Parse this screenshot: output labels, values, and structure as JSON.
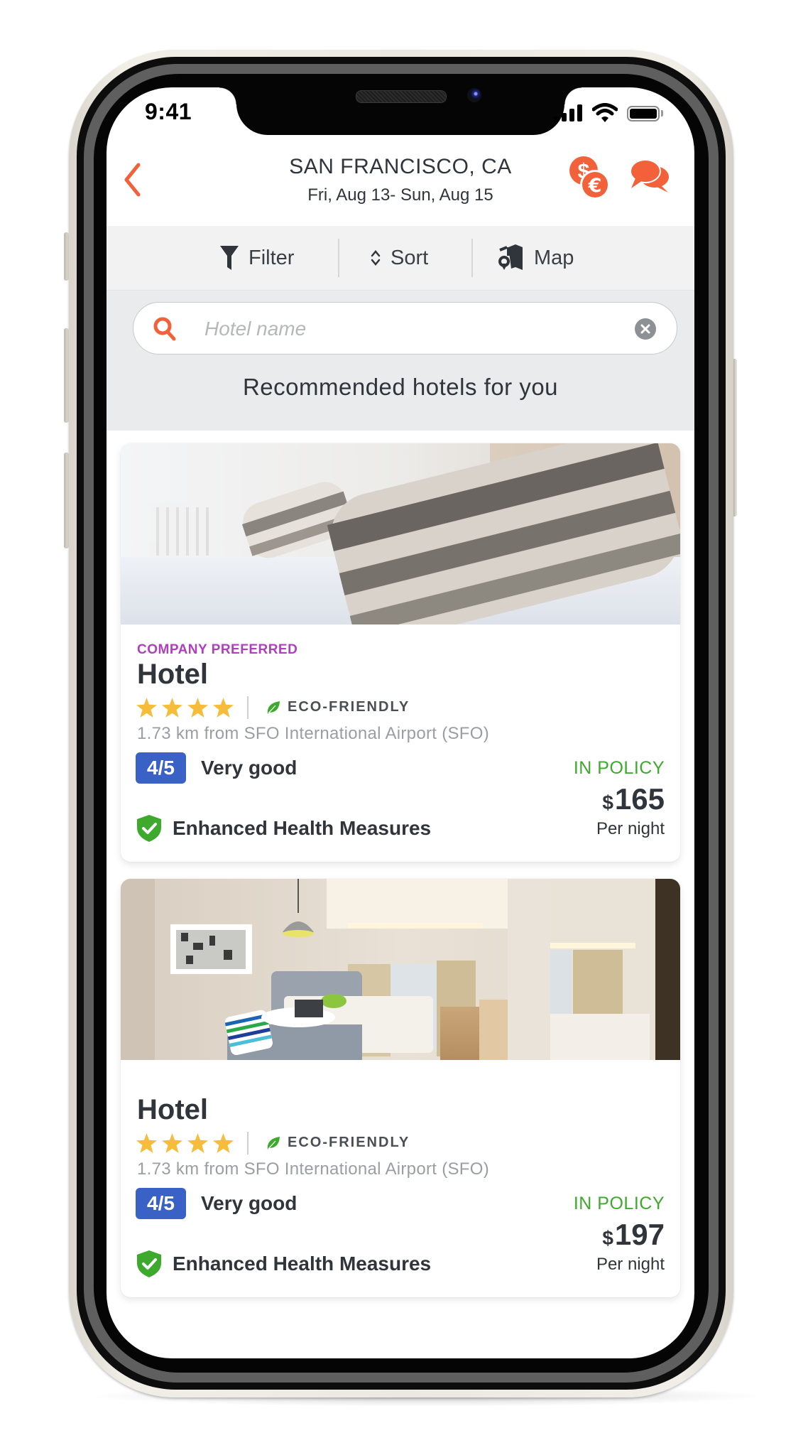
{
  "status_bar": {
    "time": "9:41"
  },
  "header": {
    "title": "SAN FRANCISCO, CA",
    "dates": "Fri, Aug 13- Sun, Aug 15",
    "back_icon": "chevron-left-icon",
    "currency_icon": "currency-exchange-icon",
    "chat_icon": "chat-bubbles-icon"
  },
  "toolbar": {
    "filter_label": "Filter",
    "sort_label": "Sort",
    "map_label": "Map"
  },
  "search": {
    "placeholder": "Hotel name",
    "value": ""
  },
  "section_title": "Recommended hotels for you",
  "colors": {
    "accent": "#F26139",
    "preferred": "#B03FBF",
    "in_policy": "#3CAA2A",
    "rating_badge": "#3A62C6",
    "star": "#F6BD3A",
    "health_shield": "#3DAA2E",
    "eco_leaf": "#3DAA2E"
  },
  "hotels": [
    {
      "tag": "COMPANY PREFERRED",
      "name": "Hotel",
      "stars": 4,
      "eco_label": "ECO-FRIENDLY",
      "distance": "1.73 km from SFO International Airport (SFO)",
      "rating": "4/5",
      "rating_text": "Very good",
      "health": "Enhanced Health Measures",
      "policy": "IN POLICY",
      "currency": "$",
      "price": "165",
      "per_night": "Per night",
      "photo": "bedroom-pillows-photo"
    },
    {
      "tag": "",
      "name": "Hotel",
      "stars": 4,
      "eco_label": "ECO-FRIENDLY",
      "distance": "1.73 km from SFO International Airport (SFO)",
      "rating": "4/5",
      "rating_text": "Very good",
      "health": "Enhanced Health Measures",
      "policy": "IN POLICY",
      "currency": "$",
      "price": "197",
      "per_night": "Per night",
      "photo": "hotel-room-interior-photo"
    }
  ]
}
